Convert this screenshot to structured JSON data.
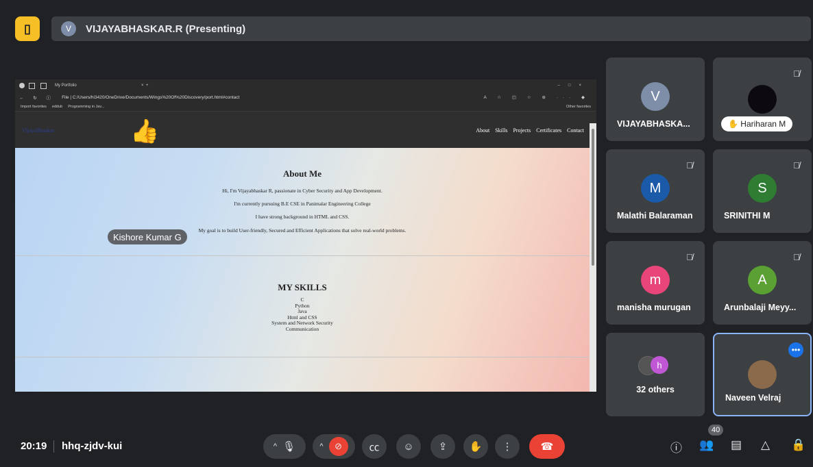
{
  "meeting": {
    "presenter_initial": "V",
    "presenter_banner": "VIJAYABHASKAR.R (Presenting)",
    "time": "20:19",
    "code": "hhq-zjdv-kui",
    "participant_count": "40"
  },
  "browser": {
    "tab_title": "My Portfolio",
    "url": "File | C:/Users/hi3420/OneDrive/Documents/Wings%20Of%20Discovery/port.html#contact",
    "favorites": [
      "Import favorites",
      "eddub",
      "Programming in Jav..."
    ],
    "other_favorites": "Other favorites"
  },
  "site": {
    "brand": "VijayaBhaskar",
    "nav": [
      "About",
      "Skills",
      "Projects",
      "Certificates",
      "Contact"
    ],
    "about_title": "About Me",
    "about_lines": [
      "Hi, I'm Vijayabhaskar R, passionate in Cyber Security and App Development.",
      "I'm currently pursuing B.E CSE in Panimalar Engineering College",
      "I have strong background in HTML and CSS.",
      "My goal is to build User-friendly, Secured and Efficient Applications that solve real-world problems."
    ],
    "skills_title": "MY SKILLS",
    "skills": [
      "C",
      "Python",
      "Java",
      "Html and CSS",
      "System and Network Security",
      "Communication"
    ]
  },
  "reaction": {
    "emoji": "👍",
    "name": "Kishore Kumar G"
  },
  "tiles": [
    {
      "name": "VIJAYABHASKA...",
      "initial": "V",
      "color": "#7e8ea8",
      "muted": false
    },
    {
      "name": "Hariharan M",
      "muted": true
    },
    {
      "name": "Malathi Balaraman",
      "initial": "M",
      "color": "#1a5aa8",
      "muted": true
    },
    {
      "name": "SRINITHI M",
      "initial": "S",
      "color": "#2e7d32",
      "muted": true
    },
    {
      "name": "manisha murugan",
      "initial": "m",
      "color": "#e8457a",
      "muted": true
    },
    {
      "name": "Arunbalaji Meyy...",
      "initial": "A",
      "color": "#5aa032",
      "muted": true
    },
    {
      "name": "32 others",
      "initial": "h",
      "color": "#c058d6"
    },
    {
      "name": "Naveen Velraj"
    }
  ]
}
